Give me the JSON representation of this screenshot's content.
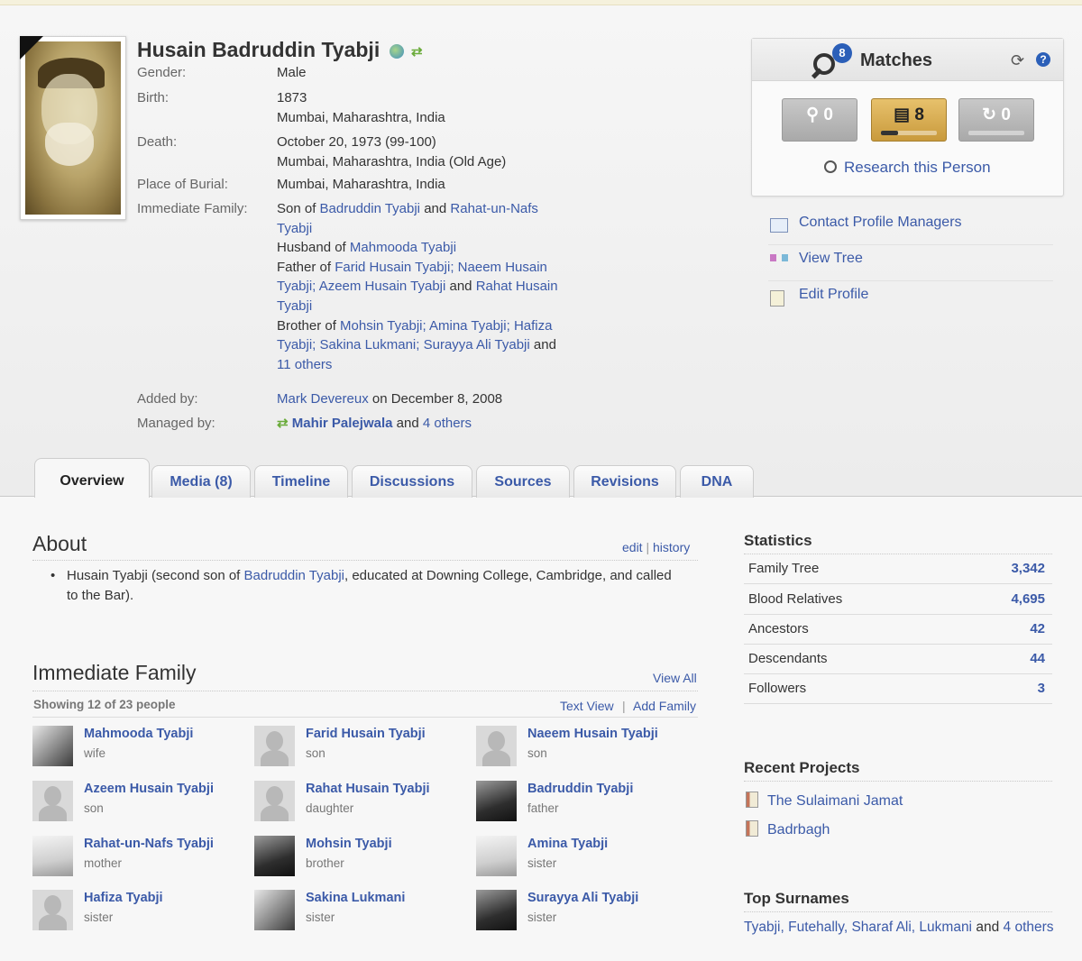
{
  "profile": {
    "name": "Husain Badruddin Tyabji",
    "fields": {
      "gender_label": "Gender:",
      "gender": "Male",
      "birth_label": "Birth:",
      "birth_date": "1873",
      "birth_place": "Mumbai, Maharashtra, India",
      "death_label": "Death:",
      "death_date": "October 20, 1973 (99-100)",
      "death_place": "Mumbai, Maharashtra, India (Old Age)",
      "burial_label": "Place of Burial:",
      "burial_place": "Mumbai, Maharashtra, India",
      "family_label": "Immediate Family:",
      "added_label": "Added by:",
      "added_by": "Mark Devereux",
      "added_on": "on December 8, 2008",
      "managed_label": "Managed by:",
      "managed_by": "Mahir Palejwala",
      "managed_and": "and",
      "managed_others": "4 others"
    },
    "family_lines": {
      "son_of_prefix": "Son of",
      "son_of_1": "Badruddin Tyabji",
      "and": "and",
      "son_of_2a": "Rahat-un-Nafs",
      "son_of_2b": "Tyabji",
      "husband_prefix": "Husband of",
      "husband_of": "Mahmooda Tyabji",
      "father_prefix": "Father of",
      "father_1": "Farid Husain Tyabji;",
      "father_2a": "Naeem Husain",
      "father_2b": "Tyabji;",
      "father_3": "Azeem Husain Tyabji",
      "father_4a": "Rahat Husain",
      "father_4b": "Tyabji",
      "brother_prefix": "Brother of",
      "brother_1": "Mohsin Tyabji;",
      "brother_2": "Amina Tyabji;",
      "brother_3a": "Hafiza",
      "brother_3b": "Tyabji;",
      "brother_4": "Sakina Lukmani;",
      "brother_5": "Surayya Ali Tyabji",
      "brother_more": "11 others"
    }
  },
  "matches": {
    "title": "Matches",
    "badge": "8",
    "buttons": [
      {
        "icon": "tree-match-icon",
        "count": "0"
      },
      {
        "icon": "record-match-icon",
        "count": "8",
        "progress": 0.3
      },
      {
        "icon": "sync-icon",
        "count": "0"
      }
    ],
    "research_label": "Research this Person"
  },
  "side_links": [
    {
      "label": "Contact Profile Managers",
      "icon": "mail-icon"
    },
    {
      "label": "View Tree",
      "icon": "tree-icon"
    },
    {
      "label": "Edit Profile",
      "icon": "edit-icon"
    }
  ],
  "tabs": [
    "Overview",
    "Media (8)",
    "Timeline",
    "Discussions",
    "Sources",
    "Revisions",
    "DNA"
  ],
  "about": {
    "title": "About",
    "edit": "edit",
    "sep": "|",
    "history": "history",
    "text_prefix": "Husain Tyabji (second son of",
    "text_link": "Badruddin Tyabji",
    "text_suffix": ", educated at Downing College, Cambridge, and called to the Bar)."
  },
  "immediate_family": {
    "title": "Immediate Family",
    "view_all": "View All",
    "showing": "Showing 12 of 23 people",
    "text_view": "Text View",
    "add_family": "Add Family",
    "members": [
      {
        "name": "Mahmooda Tyabji",
        "relation": "wife"
      },
      {
        "name": "Farid Husain Tyabji",
        "relation": "son"
      },
      {
        "name": "Naeem Husain Tyabji",
        "relation": "son"
      },
      {
        "name": "Azeem Husain Tyabji",
        "relation": "son"
      },
      {
        "name": "Rahat Husain Tyabji",
        "relation": "daughter"
      },
      {
        "name": "Badruddin Tyabji",
        "relation": "father"
      },
      {
        "name": "Rahat-un-Nafs Tyabji",
        "relation": "mother"
      },
      {
        "name": "Mohsin Tyabji",
        "relation": "brother"
      },
      {
        "name": "Amina Tyabji",
        "relation": "sister"
      },
      {
        "name": "Hafiza Tyabji",
        "relation": "sister"
      },
      {
        "name": "Sakina Lukmani",
        "relation": "sister"
      },
      {
        "name": "Surayya Ali Tyabji",
        "relation": "sister"
      }
    ]
  },
  "statistics": {
    "title": "Statistics",
    "rows": [
      {
        "label": "Family Tree",
        "value": "3,342"
      },
      {
        "label": "Blood Relatives",
        "value": "4,695"
      },
      {
        "label": "Ancestors",
        "value": "42"
      },
      {
        "label": "Descendants",
        "value": "44"
      },
      {
        "label": "Followers",
        "value": "3"
      }
    ]
  },
  "recent_projects": {
    "title": "Recent Projects",
    "items": [
      "The Sulaimani Jamat",
      "Badrbagh"
    ]
  },
  "top_surnames": {
    "title": "Top Surnames",
    "names": "Tyabji, Futehally, Sharaf Ali, Lukmani",
    "and": "and",
    "others": "4 others"
  },
  "colors": {
    "link": "#3b5aa8",
    "badge": "#2b5fb8",
    "active_match": "#d9ad55"
  }
}
